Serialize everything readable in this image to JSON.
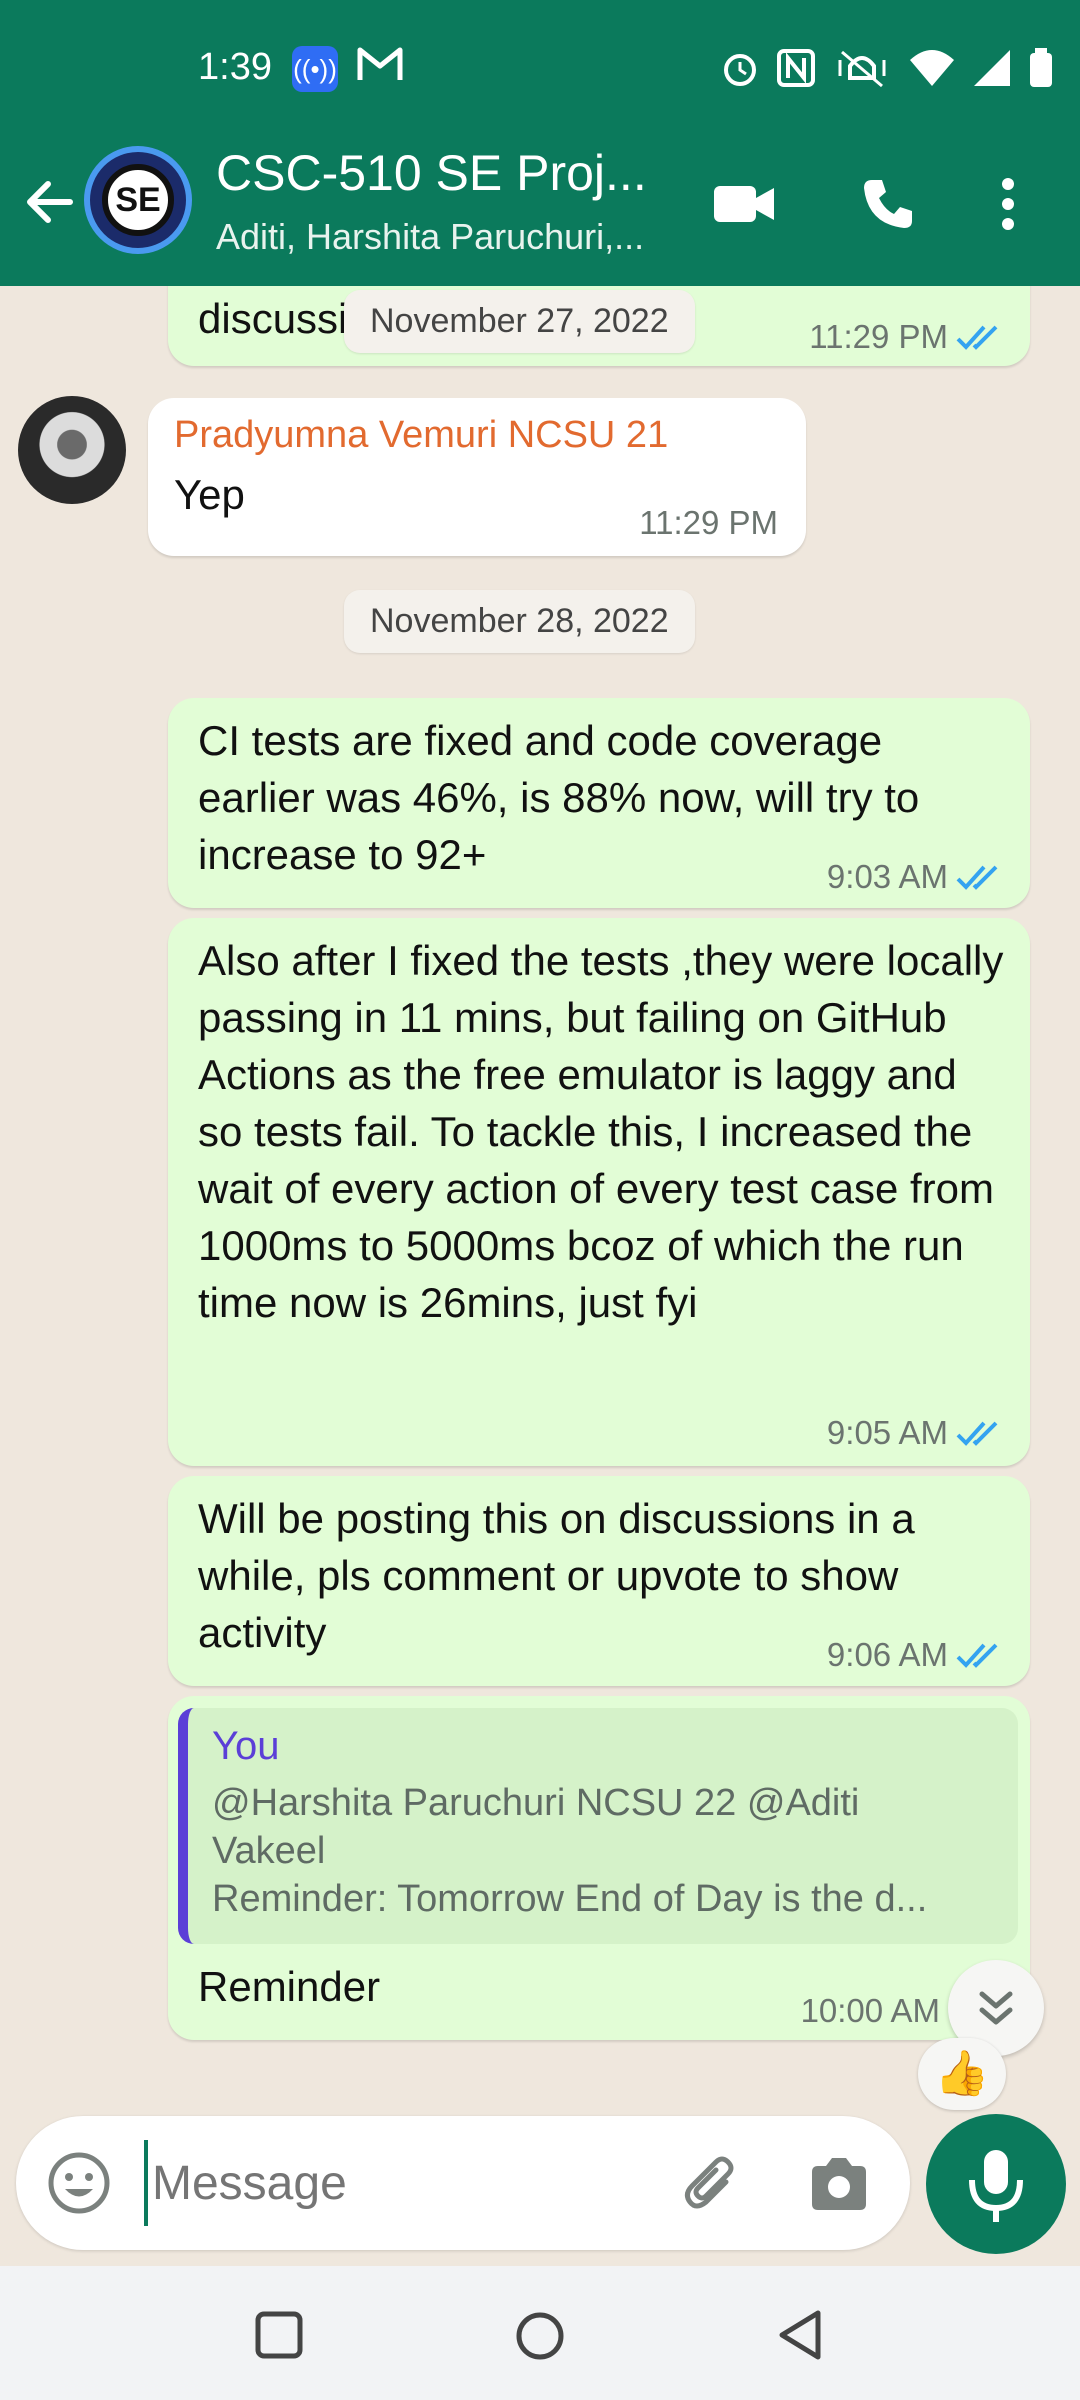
{
  "status_bar": {
    "time": "1:39"
  },
  "header": {
    "avatar_text": "SE",
    "title": "CSC-510 SE Proj...",
    "subtitle": "Aditi, Harshita Paruchuri,..."
  },
  "messages": {
    "m0": {
      "text_partial": "discussion only then",
      "time": "11:29 PM"
    },
    "date1": "November 27, 2022",
    "m1": {
      "sender": "Pradyumna Vemuri NCSU 21",
      "text": "Yep",
      "time": "11:29 PM"
    },
    "date2": "November 28, 2022",
    "m2": {
      "text": "CI tests are fixed and code coverage earlier was 46%, is 88% now, will try to increase to 92+",
      "time": "9:03 AM"
    },
    "m3": {
      "text": "Also after I fixed the tests ,they were locally passing in 11 mins, but failing on GitHub Actions as the free emulator is laggy and so tests fail. To tackle this, I increased the wait of every action of every test case from 1000ms to 5000ms bcoz of which the run time now is 26mins, just fyi",
      "time": "9:05 AM"
    },
    "m4": {
      "text": "Will be posting this on discussions in a while, pls comment or upvote to show activity",
      "time": "9:06 AM"
    },
    "m5": {
      "quote_name": "You",
      "quote_line1": "@Harshita Paruchuri NCSU 22 @Aditi Vakeel",
      "quote_line2": "Reminder: Tomorrow End of Day is the d...",
      "text": "Reminder",
      "time": "10:00 AM",
      "reaction": "👍"
    }
  },
  "composer": {
    "placeholder": "Message"
  },
  "colors": {
    "header_green": "#0b7a5c",
    "outgoing_bubble": "#e2fdd6",
    "read_tick_blue": "#34a3f0",
    "sender_orange": "#e26a2f",
    "quote_purple": "#5b3fd7"
  }
}
